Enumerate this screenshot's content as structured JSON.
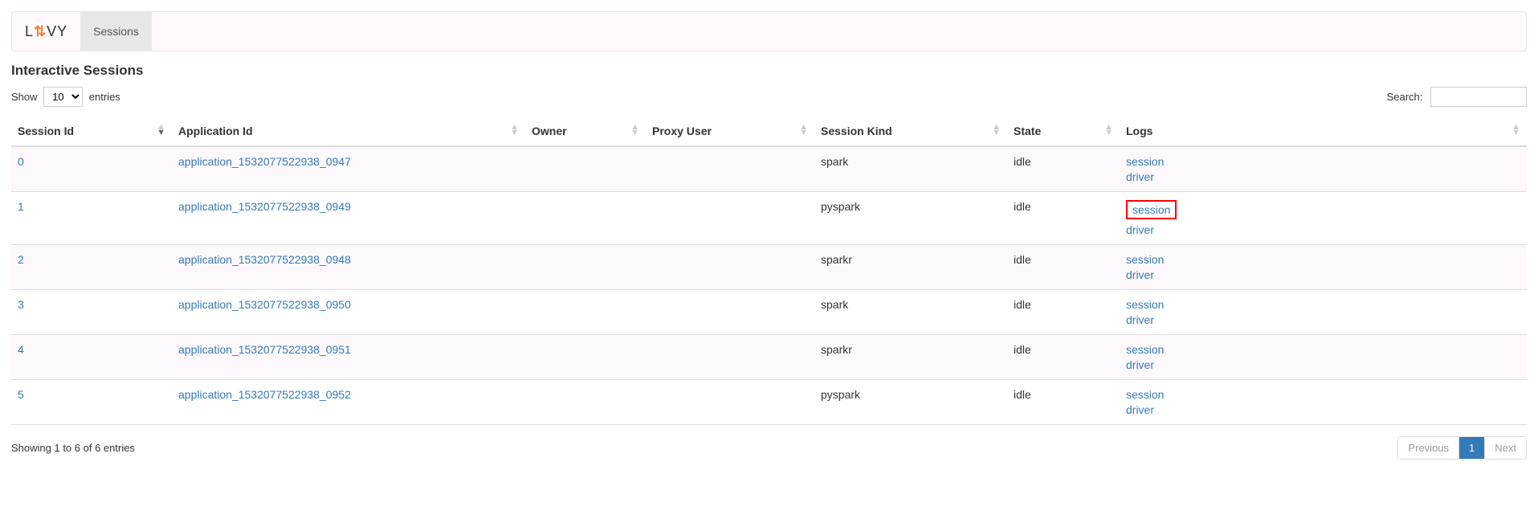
{
  "nav": {
    "brand_left": "L",
    "brand_right": "VY",
    "sessions_label": "Sessions"
  },
  "page": {
    "heading": "Interactive Sessions"
  },
  "datatable": {
    "show_label": "Show",
    "entries_label": "entries",
    "page_size": "10",
    "search_label": "Search:",
    "info": "Showing 1 to 6 of 6 entries",
    "prev": "Previous",
    "next": "Next",
    "page_num": "1"
  },
  "columns": {
    "session_id": "Session Id",
    "application_id": "Application Id",
    "owner": "Owner",
    "proxy_user": "Proxy User",
    "session_kind": "Session Kind",
    "state": "State",
    "logs": "Logs"
  },
  "rows": [
    {
      "session_id": "0",
      "application_id": "application_1532077522938_0947",
      "owner": "",
      "proxy_user": "",
      "session_kind": "spark",
      "state": "idle",
      "log_session": "session",
      "log_driver": "driver",
      "highlight": false
    },
    {
      "session_id": "1",
      "application_id": "application_1532077522938_0949",
      "owner": "",
      "proxy_user": "",
      "session_kind": "pyspark",
      "state": "idle",
      "log_session": "session",
      "log_driver": "driver",
      "highlight": true
    },
    {
      "session_id": "2",
      "application_id": "application_1532077522938_0948",
      "owner": "",
      "proxy_user": "",
      "session_kind": "sparkr",
      "state": "idle",
      "log_session": "session",
      "log_driver": "driver",
      "highlight": false
    },
    {
      "session_id": "3",
      "application_id": "application_1532077522938_0950",
      "owner": "",
      "proxy_user": "",
      "session_kind": "spark",
      "state": "idle",
      "log_session": "session",
      "log_driver": "driver",
      "highlight": false
    },
    {
      "session_id": "4",
      "application_id": "application_1532077522938_0951",
      "owner": "",
      "proxy_user": "",
      "session_kind": "sparkr",
      "state": "idle",
      "log_session": "session",
      "log_driver": "driver",
      "highlight": false
    },
    {
      "session_id": "5",
      "application_id": "application_1532077522938_0952",
      "owner": "",
      "proxy_user": "",
      "session_kind": "pyspark",
      "state": "idle",
      "log_session": "session",
      "log_driver": "driver",
      "highlight": false
    }
  ]
}
